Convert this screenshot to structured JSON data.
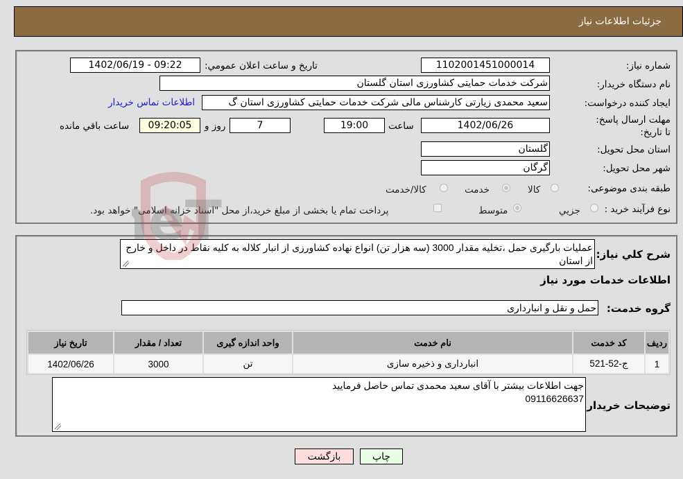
{
  "header": {
    "title": "جزئیات اطلاعات نیاز"
  },
  "details": {
    "need_number": {
      "label": "شماره نیاز:",
      "value": "1102001451000014"
    },
    "announce_datetime": {
      "label": "تاریخ و ساعت اعلان عمومي:",
      "value": "1402/06/19 - 09:22"
    },
    "buyer_org": {
      "label": "نام دستگاه خريدار:",
      "value": "شرکت خدمات حمایتی کشاورزی استان گلستان"
    },
    "requester": {
      "label": "ایجاد کننده درخواست:",
      "value": "سعید محمدی زیارتی کارشناس مالی شرکت خدمات حمایتی کشاورزی استان گ",
      "contact_link": "اطلاعات تماس خریدار"
    },
    "deadline": {
      "label": "مهلت ارسال پاسخ: تا تاریخ:",
      "date": "1402/06/26",
      "time_label": "ساعت",
      "time": "19:00",
      "days": "7",
      "days_label": "روز و",
      "remaining": "09:20:05",
      "remaining_label": "ساعت باقي مانده"
    },
    "delivery_province": {
      "label": "استان محل تحویل:",
      "value": "گلستان"
    },
    "delivery_city": {
      "label": "شهر محل تحویل:",
      "value": "گرگان"
    },
    "category": {
      "label": "طبقه بندی موضوعی:",
      "options": [
        "کالا",
        "خدمت",
        "کالا/خدمت"
      ],
      "selected": "خدمت"
    },
    "purchase_process": {
      "label": "نوع فرآیند خرید :",
      "options": [
        "جزيي",
        "متوسط"
      ],
      "selected": "متوسط",
      "treasury_note": "پرداخت تمام یا بخشی از مبلغ خرید،از محل \"اسناد خزانه اسلامی\" خواهد بود."
    }
  },
  "description": {
    "label": "شرح کلي نياز:",
    "text": "عملیات بارگیری حمل ،تخلیه مقدار 3000 (سه هزار تن) انواع نهاده کشاورزی از انبار کلاله به کلیه نقاط در داخل و خارج از استان"
  },
  "services_section": {
    "title": "اطلاعات خدمات مورد نياز",
    "service_group_label": "گروه خدمت:",
    "service_group_value": "حمل و نقل و انبارداری"
  },
  "table": {
    "columns": [
      "رديف",
      "کد خدمت",
      "نام خدمت",
      "واحد اندازه گيری",
      "تعداد / مقدار",
      "تاريخ نياز"
    ],
    "rows": [
      [
        "1",
        "ج-52-521",
        "انبارداری و ذخیره سازی",
        "تن",
        "3000",
        "1402/06/26"
      ]
    ]
  },
  "buyer_notes": {
    "label": "توضيحات خريدار:",
    "line1": "جهت اطلاعات بیشتر با آقای سعید محمدی تماس حاصل فرمایید",
    "line2": "09116626637"
  },
  "buttons": {
    "print": "چاپ",
    "back": "بازگشت"
  },
  "watermark": {
    "text": "AriaTender.neT"
  }
}
